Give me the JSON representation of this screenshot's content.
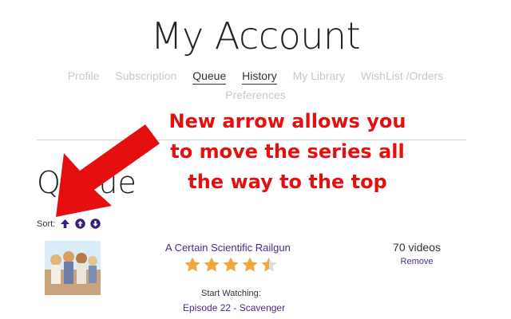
{
  "page": {
    "title": "My Account"
  },
  "nav": {
    "tabs": [
      {
        "label": "Profile",
        "active": false
      },
      {
        "label": "Subscription",
        "active": false
      },
      {
        "label": "Queue",
        "active": true
      },
      {
        "label": "History",
        "active": true
      },
      {
        "label": "My Library",
        "active": false
      },
      {
        "label": "WishList /Orders",
        "active": false
      },
      {
        "label": "Preferences",
        "active": false
      }
    ]
  },
  "annotation": {
    "text": "New arrow allows you to move the series all the way to the top",
    "color": "#e60f0f"
  },
  "queue": {
    "heading": "Queue",
    "sort": {
      "label": "Sort:",
      "buttons": [
        {
          "icon": "arrow-up-icon"
        },
        {
          "icon": "circle-arrow-up-icon"
        },
        {
          "icon": "circle-arrow-down-icon"
        }
      ]
    },
    "items": [
      {
        "title": "A Certain Scientific Railgun",
        "rating": 4.5,
        "max_rating": 5,
        "start_label": "Start Watching:",
        "episode": "Episode 22 - Scavenger",
        "video_count": "70 videos",
        "remove_label": "Remove"
      }
    ]
  },
  "colors": {
    "accent": "#4b2a8a",
    "star": "#f2a93b",
    "star_empty": "#dcdcdc",
    "annotation": "#e60f0f"
  }
}
